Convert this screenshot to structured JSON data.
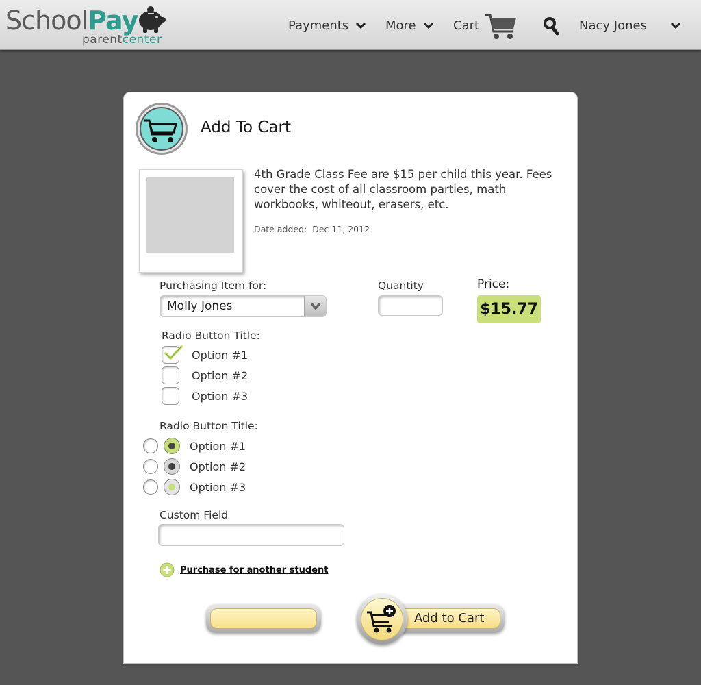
{
  "header": {
    "logo": {
      "word_school": "School",
      "word_pay": "Pay",
      "sub_parent": "parent",
      "sub_center": "center",
      "icon": "piggy-bank-icon"
    },
    "nav": {
      "payments": "Payments",
      "more": "More",
      "cart": "Cart",
      "user": "Nacy Jones"
    },
    "icons": {
      "cart": "shopping-cart-icon",
      "search": "search-icon",
      "chevron": "chevron-down-icon"
    }
  },
  "modal": {
    "title": "Add To Cart",
    "description": "4th Grade Class Fee are $15 per child this year. Fees cover the cost of all classroom parties, math workbooks, whiteout, erasers, etc.",
    "date_label": "Date added:",
    "date_value": "Dec 11, 2012",
    "purchasing_label": "Purchasing Item for:",
    "purchasing_value": "Molly Jones",
    "quantity_label": "Quantity",
    "quantity_value": "",
    "price_label": "Price:",
    "price_value": "$15.77",
    "checkbox_group": {
      "title": "Radio Button Title:",
      "options": [
        {
          "label": "Option #1",
          "checked": true
        },
        {
          "label": "Option #2",
          "checked": false
        },
        {
          "label": "Option #3",
          "checked": false
        }
      ]
    },
    "radio_group": {
      "title": "Radio Button Title:",
      "options": [
        {
          "label": "Option #1"
        },
        {
          "label": "Option #2"
        },
        {
          "label": "Option #3"
        }
      ]
    },
    "custom_field_label": "Custom Field",
    "custom_field_value": "",
    "another_student_link": "Purchase for another student",
    "secondary_button_label": "",
    "add_to_cart_label": "Add to Cart"
  },
  "colors": {
    "background": "#555555",
    "accent_green": "#c9e07a",
    "logo_teal": "#2f9a8e",
    "button_yellow": "#f8e08a",
    "cart_badge_teal": "#7fdcd4"
  }
}
